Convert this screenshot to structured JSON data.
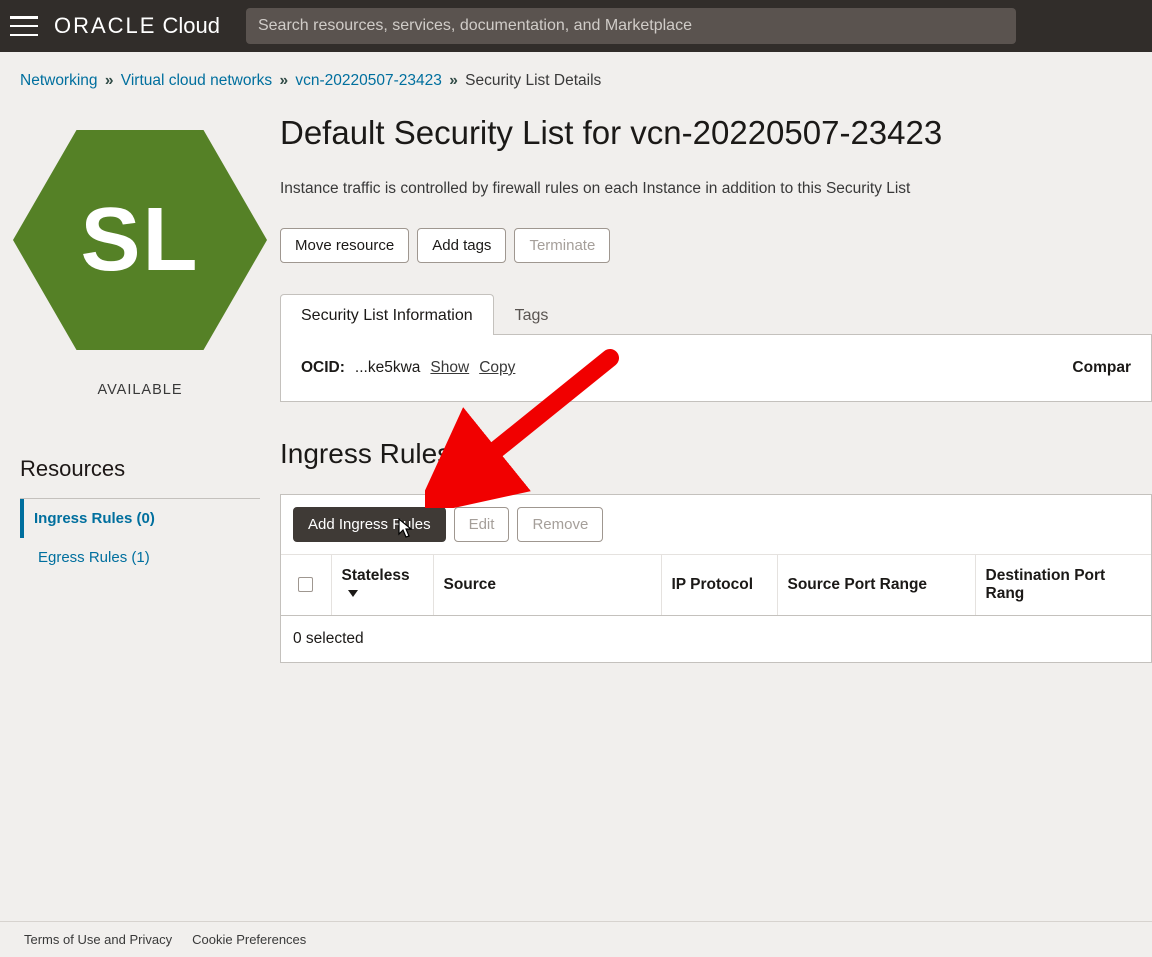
{
  "header": {
    "brand_oracle": "ORACLE",
    "brand_cloud": "Cloud",
    "search_placeholder": "Search resources, services, documentation, and Marketplace"
  },
  "breadcrumb": {
    "items": [
      {
        "label": "Networking"
      },
      {
        "label": "Virtual cloud networks"
      },
      {
        "label": "vcn-20220507-23423"
      }
    ],
    "current": "Security List Details"
  },
  "left": {
    "hex_initials": "SL",
    "status": "AVAILABLE",
    "resources_heading": "Resources",
    "links": {
      "ingress": "Ingress Rules (0)",
      "egress": "Egress Rules (1)"
    }
  },
  "main": {
    "title": "Default Security List for vcn-20220507-23423",
    "description": "Instance traffic is controlled by firewall rules on each Instance in addition to this Security List",
    "buttons": {
      "move": "Move resource",
      "add_tags": "Add tags",
      "terminate": "Terminate"
    },
    "tabs": {
      "info": "Security List Information",
      "tags": "Tags"
    },
    "ocid": {
      "label": "OCID:",
      "value": "...ke5kwa",
      "show": "Show",
      "copy": "Copy"
    },
    "compartment_label": "Compar",
    "ingress": {
      "heading": "Ingress Rules",
      "add_btn": "Add Ingress Rules",
      "edit": "Edit",
      "remove": "Remove",
      "cols": {
        "stateless": "Stateless",
        "source": "Source",
        "ip": "IP Protocol",
        "spr": "Source Port Range",
        "dpr": "Destination Port Rang"
      },
      "selected": "0 selected"
    }
  },
  "footer": {
    "terms": "Terms of Use and Privacy",
    "cookies": "Cookie Preferences"
  }
}
